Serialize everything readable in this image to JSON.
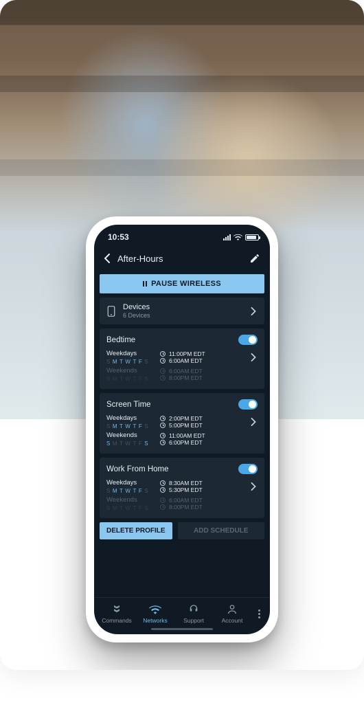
{
  "status": {
    "time": "10:53"
  },
  "header": {
    "title": "After-Hours"
  },
  "pause_label": "PAUSE WIRELESS",
  "devices": {
    "title": "Devices",
    "subtitle": "6 Devices"
  },
  "schedules": [
    {
      "name": "Bedtime",
      "blocks": [
        {
          "label": "Weekdays",
          "days": "SMTWTFS",
          "days_on": [
            1,
            2,
            3,
            4,
            5
          ],
          "start": "11:00PM EDT",
          "end": "6:00AM EDT",
          "active": true
        },
        {
          "label": "Weekends",
          "days": "SMTWTFS",
          "days_on": [],
          "start": "6:00AM EDT",
          "end": "8:00PM EDT",
          "active": false
        }
      ]
    },
    {
      "name": "Screen Time",
      "blocks": [
        {
          "label": "Weekdays",
          "days": "SMTWTFS",
          "days_on": [
            1,
            2,
            3,
            4,
            5
          ],
          "start": "2:00PM EDT",
          "end": "5:00PM EDT",
          "active": true
        },
        {
          "label": "Weekends",
          "days": "SMTWTFS",
          "days_on": [
            0,
            6
          ],
          "start": "11:00AM EDT",
          "end": "6:00PM EDT",
          "active": true
        }
      ]
    },
    {
      "name": "Work From Home",
      "blocks": [
        {
          "label": "Weekdays",
          "days": "SMTWTFS",
          "days_on": [
            1,
            2,
            3,
            4,
            5
          ],
          "start": "8:30AM EDT",
          "end": "5:30PM EDT",
          "active": true
        },
        {
          "label": "Weekends",
          "days": "SMTWTFS",
          "days_on": [],
          "start": "6:00AM EDT",
          "end": "8:00PM EDT",
          "active": false
        }
      ]
    }
  ],
  "buttons": {
    "delete": "DELETE PROFILE",
    "add": "ADD SCHEDULE"
  },
  "tabs": [
    {
      "id": "commands",
      "label": "Commands"
    },
    {
      "id": "networks",
      "label": "Networks"
    },
    {
      "id": "support",
      "label": "Support"
    },
    {
      "id": "account",
      "label": "Account"
    }
  ],
  "active_tab": "networks"
}
